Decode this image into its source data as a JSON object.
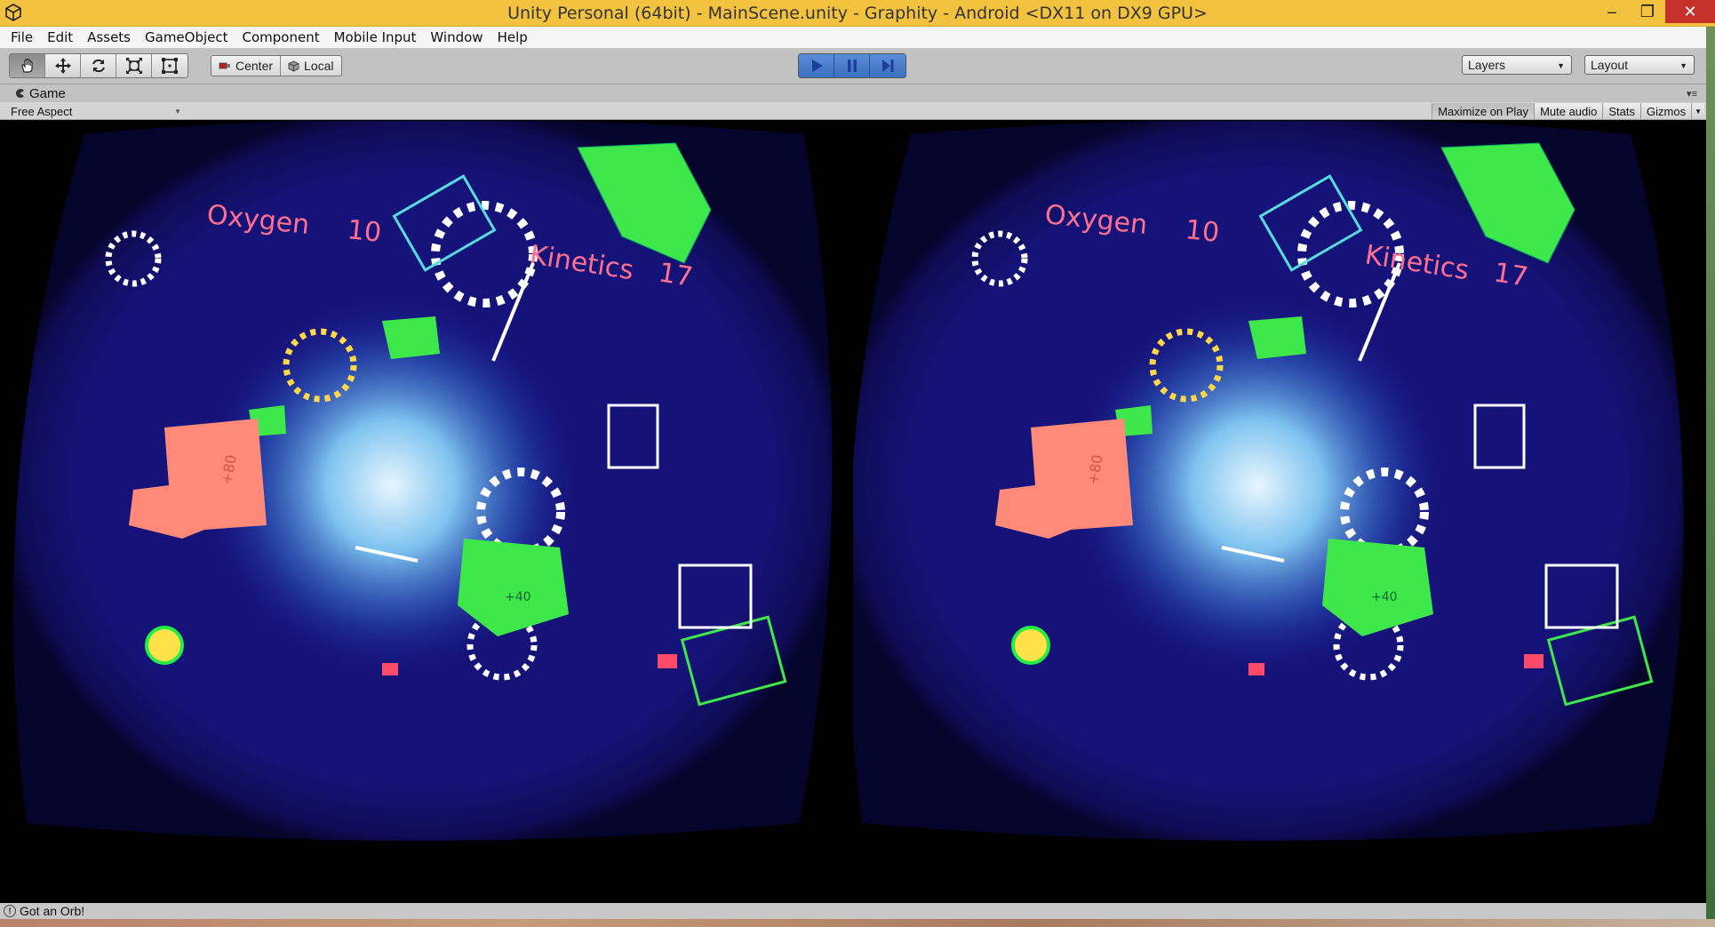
{
  "window": {
    "title": "Unity Personal (64bit) - MainScene.unity - Graphity - Android <DX11 on DX9 GPU>",
    "minimize_glyph": "–",
    "restore_glyph": "❐",
    "close_glyph": "✕"
  },
  "menu": [
    "File",
    "Edit",
    "Assets",
    "GameObject",
    "Component",
    "Mobile Input",
    "Window",
    "Help"
  ],
  "toolbar": {
    "pivot_center": "Center",
    "pivot_local": "Local",
    "layers": "Layers",
    "layout": "Layout"
  },
  "game_panel": {
    "tab": "Game",
    "aspect": "Free Aspect",
    "options": [
      "Maximize on Play",
      "Mute audio",
      "Stats",
      "Gizmos"
    ]
  },
  "scene": {
    "oxygen_label": "Oxygen",
    "oxygen_value": "10",
    "kinetics_label": "Kinetics",
    "kinetics_value": "17",
    "cube_label": "+80",
    "green_label": "+40"
  },
  "status": {
    "message": "Got an Orb!"
  }
}
